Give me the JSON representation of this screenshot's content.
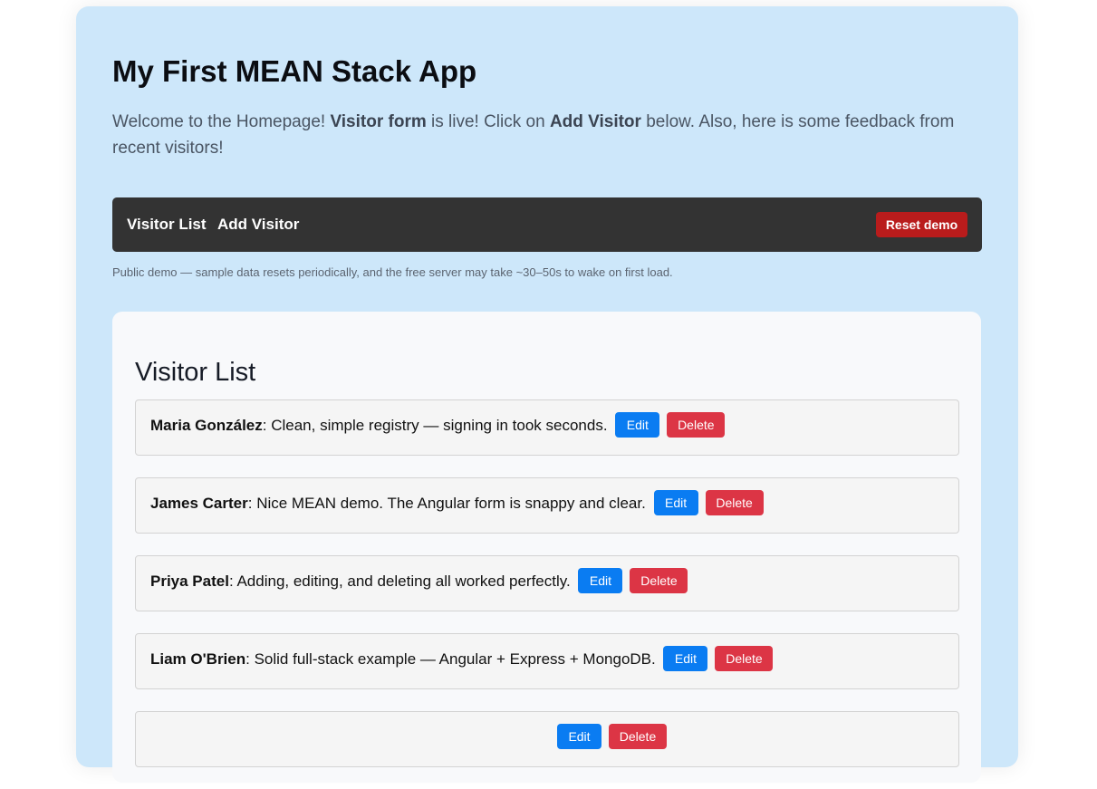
{
  "header": {
    "title": "My First MEAN Stack App",
    "intro": {
      "p1": "Welcome to the Homepage! ",
      "b1": "Visitor form",
      "p2": " is live! Click on ",
      "b2": "Add Visitor",
      "p3": " below. Also, here is some feedback from recent visitors!"
    }
  },
  "nav": {
    "links": [
      "Visitor List",
      "Add Visitor"
    ],
    "reset_label": "Reset demo"
  },
  "demo_note": "Public demo — sample data resets periodically, and the free server may take ~30–50s to wake on first load.",
  "visitor_list": {
    "title": "Visitor List",
    "edit_label": "Edit",
    "delete_label": "Delete",
    "items": [
      {
        "name": "Maria González",
        "comment": "Clean, simple registry — signing in took seconds."
      },
      {
        "name": "James Carter",
        "comment": "Nice MEAN demo. The Angular form is snappy and clear."
      },
      {
        "name": "Priya Patel",
        "comment": "Adding, editing, and deleting all worked perfectly."
      },
      {
        "name": "Liam O'Brien",
        "comment": "Solid full-stack example — Angular + Express + MongoDB."
      },
      {
        "name": "",
        "comment": ""
      }
    ]
  },
  "colors": {
    "page_bg": "#cde7fa",
    "navbar_bg": "#333333",
    "reset_bg": "#b91c1c",
    "edit_bg": "#0a7cf2",
    "delete_bg": "#dc3545"
  }
}
